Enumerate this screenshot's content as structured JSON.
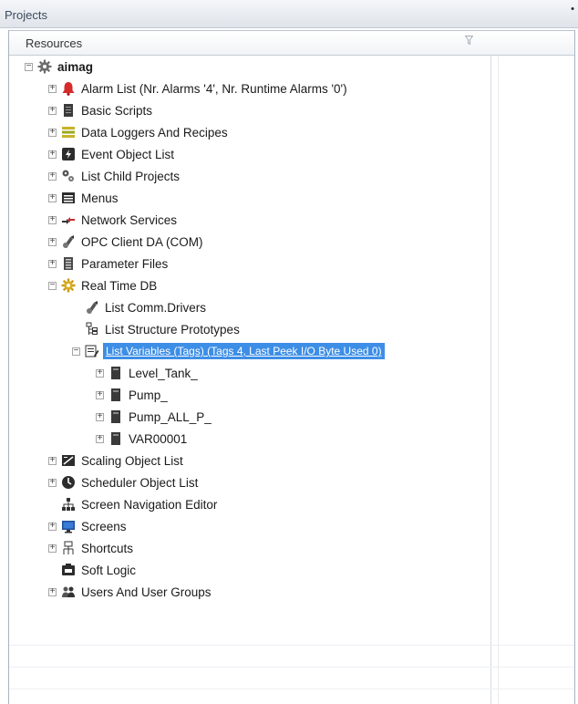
{
  "panel": {
    "title": "Projects",
    "pin_glyph": "•"
  },
  "tree": {
    "column_header": "Resources",
    "filter_icon": "filter-icon",
    "root": {
      "label": "aimag",
      "expanded": true
    },
    "items": [
      {
        "label": "Alarm List (Nr. Alarms '4', Nr. Runtime Alarms '0')",
        "icon": "alarm-bell-icon"
      },
      {
        "label": "Basic Scripts",
        "icon": "script-icon"
      },
      {
        "label": "Data Loggers And Recipes",
        "icon": "database-icon"
      },
      {
        "label": "Event Object List",
        "icon": "event-icon"
      },
      {
        "label": "List Child Projects",
        "icon": "child-projects-icon"
      },
      {
        "label": "Menus",
        "icon": "menu-icon"
      },
      {
        "label": "Network Services",
        "icon": "network-icon"
      },
      {
        "label": "OPC Client DA (COM)",
        "icon": "opc-icon"
      },
      {
        "label": "Parameter Files",
        "icon": "parameter-icon"
      },
      {
        "label": "Real Time DB",
        "icon": "realtime-db-icon",
        "expanded": true
      },
      {
        "label": "List Comm.Drivers",
        "icon": "comm-driver-icon"
      },
      {
        "label": "List Structure Prototypes",
        "icon": "structure-icon"
      },
      {
        "label": "List Variables (Tags) (Tags 4, Last Peek I/O Byte Used 0)",
        "icon": "variables-icon",
        "selected": true,
        "expanded": true
      },
      {
        "label": "Level_Tank_",
        "icon": "tag-icon"
      },
      {
        "label": "Pump_",
        "icon": "tag-icon"
      },
      {
        "label": "Pump_ALL_P_",
        "icon": "tag-icon"
      },
      {
        "label": "VAR00001",
        "icon": "tag-icon"
      },
      {
        "label": "Scaling Object List",
        "icon": "scaling-icon"
      },
      {
        "label": "Scheduler Object List",
        "icon": "scheduler-icon"
      },
      {
        "label": "Screen Navigation Editor",
        "icon": "navigation-icon"
      },
      {
        "label": "Screens",
        "icon": "monitor-icon"
      },
      {
        "label": "Shortcuts",
        "icon": "shortcut-icon"
      },
      {
        "label": "Soft Logic",
        "icon": "soft-logic-icon"
      },
      {
        "label": "Users And User Groups",
        "icon": "users-icon"
      }
    ]
  },
  "colors": {
    "selection": "#3d8ee6",
    "alarm": "#d62b2b",
    "gear": "#c99a1a"
  }
}
